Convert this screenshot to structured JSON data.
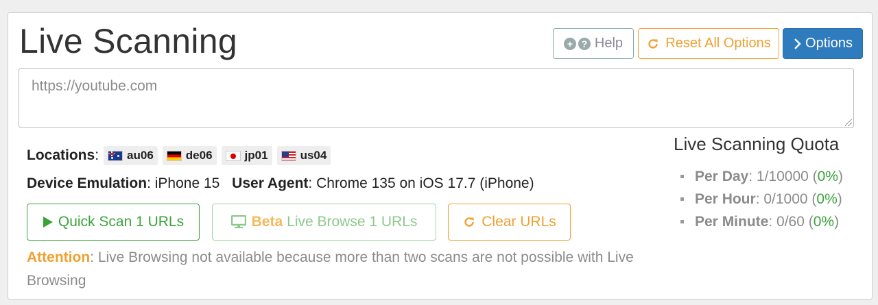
{
  "header": {
    "title": "Live Scanning",
    "help_label": "Help",
    "reset_label": "Reset All Options",
    "options_label": "Options"
  },
  "url_input": {
    "placeholder": "https://youtube.com"
  },
  "locations": {
    "label": "Locations",
    "items": [
      {
        "code": "au06",
        "flag": "au-flag"
      },
      {
        "code": "de06",
        "flag": "de-flag"
      },
      {
        "code": "jp01",
        "flag": "jp-flag"
      },
      {
        "code": "us04",
        "flag": "us-flag"
      }
    ]
  },
  "device": {
    "emulation_label": "Device Emulation",
    "emulation_value": "iPhone 15",
    "user_agent_label": "User Agent",
    "user_agent_value": "Chrome 135 on iOS 17.7 (iPhone)"
  },
  "actions": {
    "quick_scan_label": "Quick Scan 1 URLs",
    "beta_word": "Beta",
    "live_browse_label": "Live Browse 1 URLs",
    "clear_label": "Clear URLs"
  },
  "attention": {
    "label": "Attention",
    "message": "Live Browsing not available because more than two scans are not possible with Live Browsing"
  },
  "quota": {
    "title": "Live Scanning Quota",
    "per_day_label": "Per Day",
    "per_day_value": "1/10000",
    "per_day_pct": "0%",
    "per_hour_label": "Per Hour",
    "per_hour_value": "0/1000",
    "per_hour_pct": "0%",
    "per_minute_label": "Per Minute",
    "per_minute_value": "0/60",
    "per_minute_pct": "0%"
  },
  "colors": {
    "primary": "#2e7bbd",
    "warning": "#f0a030",
    "success": "#3aa33a",
    "muted": "#8b8b8b"
  }
}
